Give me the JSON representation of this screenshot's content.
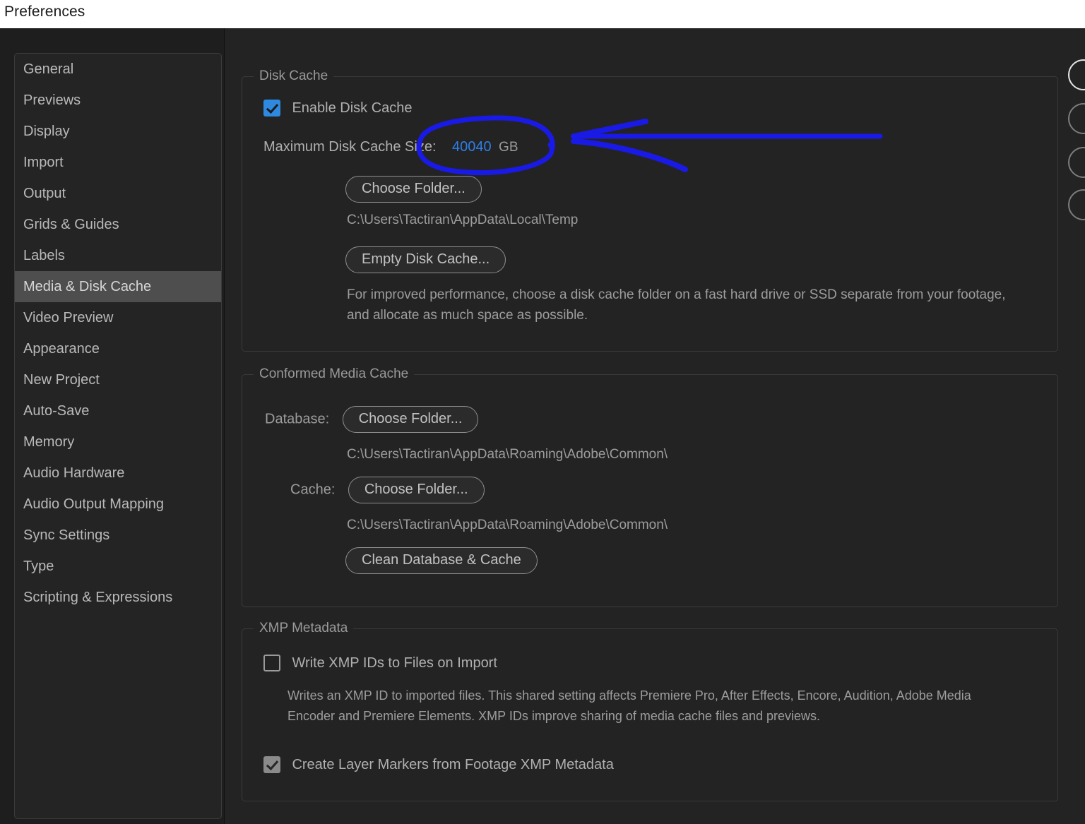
{
  "window": {
    "title": "Preferences"
  },
  "sidebar": {
    "items": [
      {
        "label": "General",
        "selected": false
      },
      {
        "label": "Previews",
        "selected": false
      },
      {
        "label": "Display",
        "selected": false
      },
      {
        "label": "Import",
        "selected": false
      },
      {
        "label": "Output",
        "selected": false
      },
      {
        "label": "Grids & Guides",
        "selected": false
      },
      {
        "label": "Labels",
        "selected": false
      },
      {
        "label": "Media & Disk Cache",
        "selected": true
      },
      {
        "label": "Video Preview",
        "selected": false
      },
      {
        "label": "Appearance",
        "selected": false
      },
      {
        "label": "New Project",
        "selected": false
      },
      {
        "label": "Auto-Save",
        "selected": false
      },
      {
        "label": "Memory",
        "selected": false
      },
      {
        "label": "Audio Hardware",
        "selected": false
      },
      {
        "label": "Audio Output Mapping",
        "selected": false
      },
      {
        "label": "Sync Settings",
        "selected": false
      },
      {
        "label": "Type",
        "selected": false
      },
      {
        "label": "Scripting & Expressions",
        "selected": false
      }
    ]
  },
  "disk_cache": {
    "group_label": "Disk Cache",
    "enable_label": "Enable Disk Cache",
    "enable_checked": true,
    "max_size_label": "Maximum Disk Cache Size:",
    "max_size_value": "40040",
    "max_size_unit": "GB",
    "choose_folder_label": "Choose Folder...",
    "cache_path": "C:\\Users\\Tactiran\\AppData\\Local\\Temp",
    "empty_cache_label": "Empty Disk Cache...",
    "help_text": "For improved performance, choose a disk cache folder on a fast hard drive or SSD separate from your footage, and allocate as much space as possible."
  },
  "conformed_media_cache": {
    "group_label": "Conformed Media Cache",
    "database_label": "Database:",
    "database_button": "Choose Folder...",
    "database_path": "C:\\Users\\Tactiran\\AppData\\Roaming\\Adobe\\Common\\",
    "cache_label": "Cache:",
    "cache_button": "Choose Folder...",
    "cache_path": "C:\\Users\\Tactiran\\AppData\\Roaming\\Adobe\\Common\\",
    "clean_button": "Clean Database & Cache"
  },
  "xmp_metadata": {
    "group_label": "XMP Metadata",
    "write_ids_label": "Write XMP IDs to Files on Import",
    "write_ids_checked": false,
    "write_ids_description": "Writes an XMP ID to imported files. This shared setting affects Premiere Pro, After Effects, Encore, Audition, Adobe Media Encoder and Premiere Elements. XMP IDs improve sharing of media cache files and previews.",
    "create_markers_label": "Create Layer Markers from Footage XMP Metadata",
    "create_markers_checked": true
  },
  "edge_buttons": [
    {
      "name": "ok-button",
      "focused": true
    },
    {
      "name": "cancel-button",
      "focused": false
    },
    {
      "name": "prev-button",
      "focused": false
    },
    {
      "name": "next-button",
      "focused": false
    }
  ],
  "annotation": {
    "color": "#1a1ae6",
    "shapes": [
      {
        "type": "ellipse",
        "target": "maximum-disk-cache-size-value"
      },
      {
        "type": "arrow",
        "direction": "left",
        "points_to": "maximum-disk-cache-size-value"
      }
    ]
  },
  "colors": {
    "accent_blue": "#2e8ae0",
    "hot_text_blue": "#2e7fe8",
    "annotation_blue": "#1a1ae6",
    "dialog_bg": "#232323",
    "sidebar_bg": "#1e1e1e",
    "selection_bg": "#4e4e4e"
  }
}
